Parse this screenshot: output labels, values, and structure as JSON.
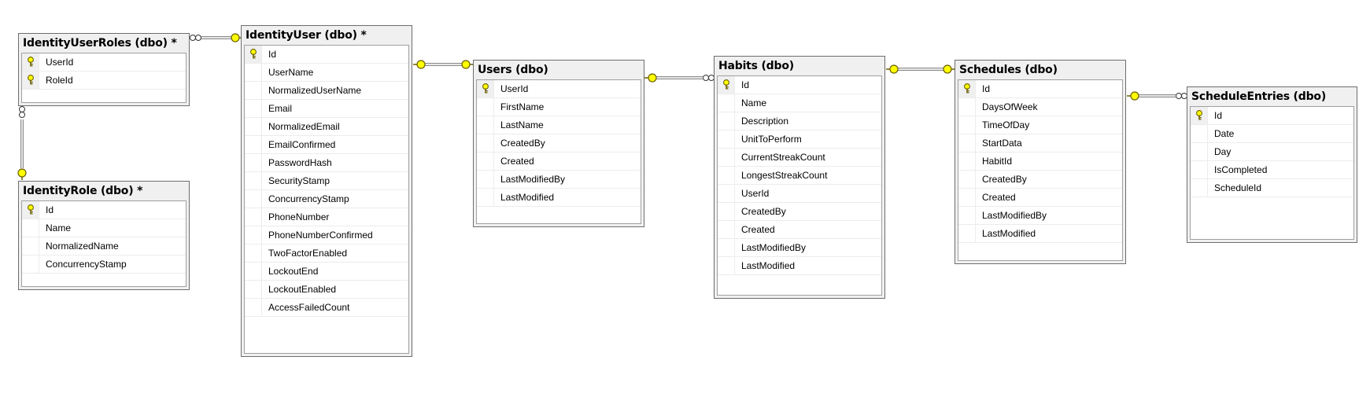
{
  "diagram": {
    "tables": [
      {
        "id": "identityuserroles",
        "title": "IdentityUserRoles (dbo) *",
        "columns": [
          {
            "name": "UserId",
            "pk": true
          },
          {
            "name": "RoleId",
            "pk": true
          }
        ]
      },
      {
        "id": "identityrole",
        "title": "IdentityRole (dbo) *",
        "columns": [
          {
            "name": "Id",
            "pk": true
          },
          {
            "name": "Name",
            "pk": false
          },
          {
            "name": "NormalizedName",
            "pk": false
          },
          {
            "name": "ConcurrencyStamp",
            "pk": false
          }
        ]
      },
      {
        "id": "identityuser",
        "title": "IdentityUser (dbo) *",
        "columns": [
          {
            "name": "Id",
            "pk": true
          },
          {
            "name": "UserName",
            "pk": false
          },
          {
            "name": "NormalizedUserName",
            "pk": false
          },
          {
            "name": "Email",
            "pk": false
          },
          {
            "name": "NormalizedEmail",
            "pk": false
          },
          {
            "name": "EmailConfirmed",
            "pk": false
          },
          {
            "name": "PasswordHash",
            "pk": false
          },
          {
            "name": "SecurityStamp",
            "pk": false
          },
          {
            "name": "ConcurrencyStamp",
            "pk": false
          },
          {
            "name": "PhoneNumber",
            "pk": false
          },
          {
            "name": "PhoneNumberConfirmed",
            "pk": false
          },
          {
            "name": "TwoFactorEnabled",
            "pk": false
          },
          {
            "name": "LockoutEnd",
            "pk": false
          },
          {
            "name": "LockoutEnabled",
            "pk": false
          },
          {
            "name": "AccessFailedCount",
            "pk": false
          }
        ]
      },
      {
        "id": "users",
        "title": "Users (dbo)",
        "columns": [
          {
            "name": "UserId",
            "pk": true
          },
          {
            "name": "FirstName",
            "pk": false
          },
          {
            "name": "LastName",
            "pk": false
          },
          {
            "name": "CreatedBy",
            "pk": false
          },
          {
            "name": "Created",
            "pk": false
          },
          {
            "name": "LastModifiedBy",
            "pk": false
          },
          {
            "name": "LastModified",
            "pk": false
          }
        ]
      },
      {
        "id": "habits",
        "title": "Habits (dbo)",
        "columns": [
          {
            "name": "Id",
            "pk": true
          },
          {
            "name": "Name",
            "pk": false
          },
          {
            "name": "Description",
            "pk": false
          },
          {
            "name": "UnitToPerform",
            "pk": false
          },
          {
            "name": "CurrentStreakCount",
            "pk": false
          },
          {
            "name": "LongestStreakCount",
            "pk": false
          },
          {
            "name": "UserId",
            "pk": false
          },
          {
            "name": "CreatedBy",
            "pk": false
          },
          {
            "name": "Created",
            "pk": false
          },
          {
            "name": "LastModifiedBy",
            "pk": false
          },
          {
            "name": "LastModified",
            "pk": false
          }
        ]
      },
      {
        "id": "schedules",
        "title": "Schedules (dbo)",
        "columns": [
          {
            "name": "Id",
            "pk": true
          },
          {
            "name": "DaysOfWeek",
            "pk": false
          },
          {
            "name": "TimeOfDay",
            "pk": false
          },
          {
            "name": "StartData",
            "pk": false
          },
          {
            "name": "HabitId",
            "pk": false
          },
          {
            "name": "CreatedBy",
            "pk": false
          },
          {
            "name": "Created",
            "pk": false
          },
          {
            "name": "LastModifiedBy",
            "pk": false
          },
          {
            "name": "LastModified",
            "pk": false
          }
        ]
      },
      {
        "id": "scheduleentries",
        "title": "ScheduleEntries (dbo)",
        "columns": [
          {
            "name": "Id",
            "pk": true
          },
          {
            "name": "Date",
            "pk": false
          },
          {
            "name": "Day",
            "pk": false
          },
          {
            "name": "IsCompleted",
            "pk": false
          },
          {
            "name": "ScheduleId",
            "pk": false
          }
        ]
      }
    ],
    "relationships": [
      {
        "from": "identityuserroles",
        "to": "identityuser",
        "from_end": "many",
        "to_end": "one"
      },
      {
        "from": "identityuserroles",
        "to": "identityrole",
        "from_end": "many",
        "to_end": "one"
      },
      {
        "from": "identityuser",
        "to": "users",
        "from_end": "one",
        "to_end": "one"
      },
      {
        "from": "users",
        "to": "habits",
        "from_end": "one",
        "to_end": "many"
      },
      {
        "from": "habits",
        "to": "schedules",
        "from_end": "one",
        "to_end": "one"
      },
      {
        "from": "schedules",
        "to": "scheduleentries",
        "from_end": "one",
        "to_end": "many"
      }
    ],
    "colors": {
      "key_yellow": "#ffff00",
      "key_outline": "#7a6a00",
      "border": "#6d6d6d",
      "title_bg": "#f0f0f0"
    }
  }
}
